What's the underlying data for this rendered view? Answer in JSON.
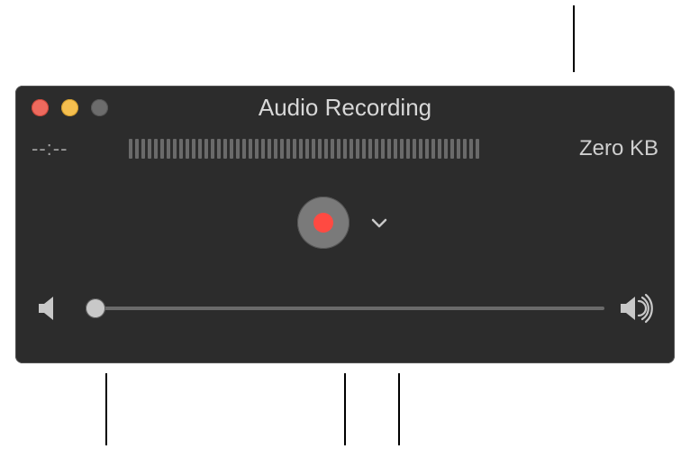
{
  "window": {
    "title": "Audio Recording"
  },
  "status": {
    "time": "--:--",
    "filesize": "Zero KB"
  },
  "volume": {
    "position_percent": 0
  },
  "meter": {
    "ticks": 56
  }
}
